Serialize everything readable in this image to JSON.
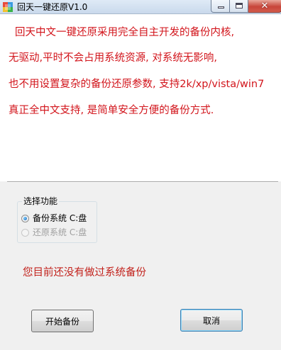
{
  "window": {
    "title": "回天一键还原V1.0",
    "close_symbol": "✕"
  },
  "description": {
    "lines": [
      "回天中文一键还原采用完全自主开发的备份内核,",
      "无驱动,平时不会占用系统资源, 对系统无影响,",
      "也不用设置复杂的备份还原参数, 支持2k/xp/vista/win7",
      "真正全中文支持, 是简单安全方便的备份方式."
    ],
    "text_color": "#d2141b"
  },
  "function_group": {
    "title": "选择功能",
    "options": [
      {
        "label": "备份系统 C:盘",
        "selected": true,
        "enabled": true
      },
      {
        "label": "还原系统 C:盘",
        "selected": false,
        "enabled": false
      }
    ]
  },
  "status_message": "您目前还没有做过系统备份",
  "buttons": {
    "start": "开始备份",
    "cancel": "取消"
  },
  "icons": [
    "app-icon",
    "minimize-icon",
    "maximize-icon",
    "close-icon"
  ]
}
